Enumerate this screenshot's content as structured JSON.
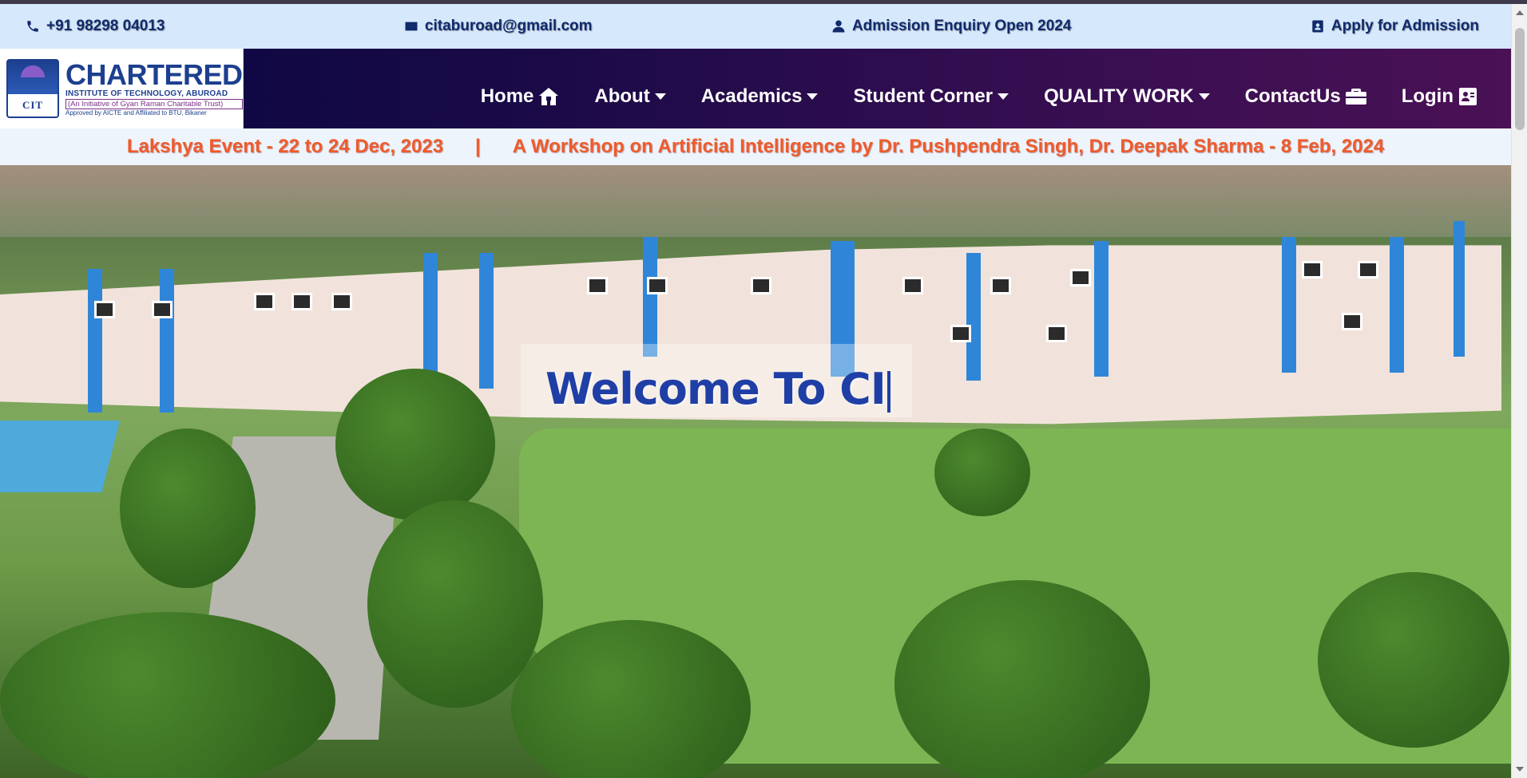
{
  "topbar": {
    "phone": "+91 98298 04013",
    "email": "citaburoad@gmail.com",
    "enquiry": "Admission Enquiry Open 2024",
    "apply": "Apply for Admission"
  },
  "logo": {
    "emblem_text": "CIT",
    "title": "CHARTERED",
    "sub1": "INSTITUTE OF TECHNOLOGY, ABUROAD",
    "sub2": "(An Initiative of Gyan Raman Charitable Trust)",
    "sub3": "Approved by AICTE and Affiliated to BTU, Bikaner"
  },
  "nav": {
    "items": [
      {
        "label": "Home",
        "icon": "home-icon"
      },
      {
        "label": "About",
        "icon": "caret-down-icon"
      },
      {
        "label": "Academics",
        "icon": "caret-down-icon"
      },
      {
        "label": "Student Corner",
        "icon": "caret-down-icon"
      },
      {
        "label": "QUALITY WORK",
        "icon": "caret-down-icon"
      },
      {
        "label": "ContactUs",
        "icon": "briefcase-icon"
      },
      {
        "label": "Login",
        "icon": "id-card-icon"
      }
    ]
  },
  "ticker": {
    "item1": "Lakshya Event - 22 to 24 Dec, 2023",
    "separator": "|",
    "item2": "A Workshop on Artificial Intelligence by Dr. Pushpendra Singh, Dr. Deepak Sharma - 8 Feb, 2024"
  },
  "hero": {
    "welcome": "Welcome To CI"
  },
  "colors": {
    "accent_blue": "#1f3fa6",
    "ticker_orange": "#ef5b2b",
    "topbar_bg": "#d6e8fb",
    "nav_gradient_start": "#070741",
    "nav_gradient_end": "#4a1155"
  }
}
